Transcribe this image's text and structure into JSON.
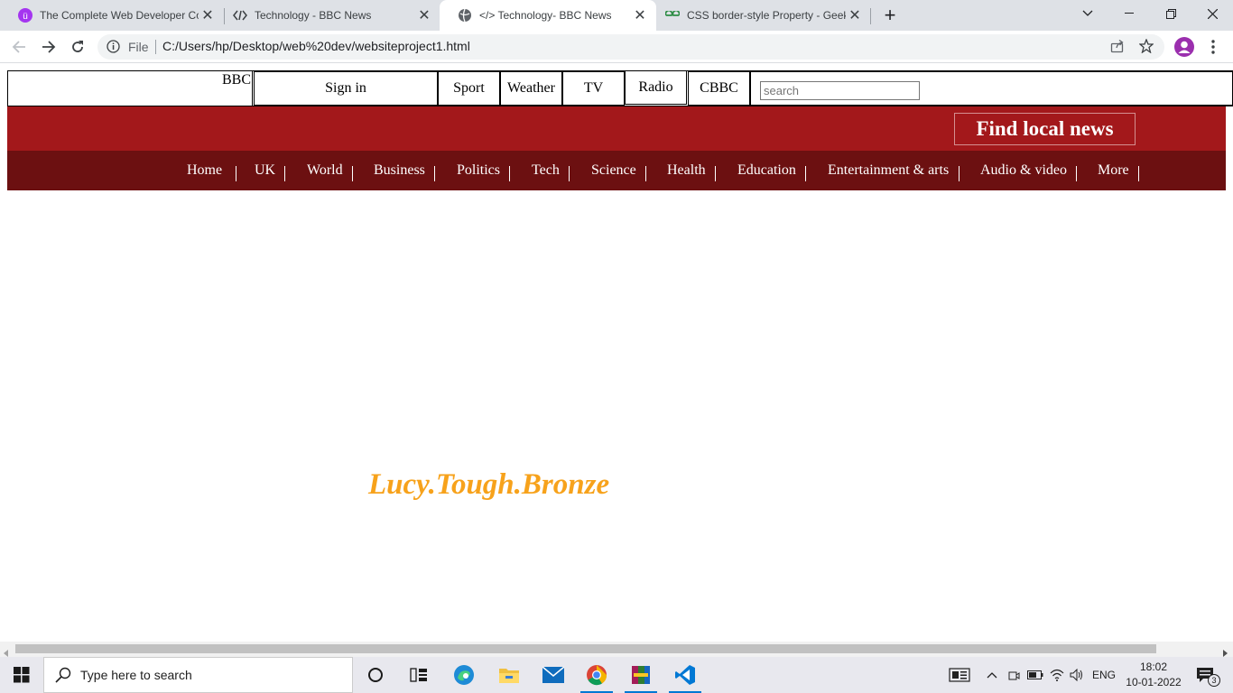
{
  "browser": {
    "tabs": [
      {
        "title": "The Complete Web Developer Co",
        "icon": "udemy-icon"
      },
      {
        "title": "Technology - BBC News",
        "icon": "code-icon"
      },
      {
        "title": "</> Technology- BBC News",
        "icon": "globe-icon"
      },
      {
        "title": "CSS border-style Property - Geek",
        "icon": "geeksforgeeks-icon"
      }
    ],
    "omnibox": {
      "scheme_label": "File",
      "url": "C:/Users/hp/Desktop/web%20dev/websiteproject1.html"
    }
  },
  "page": {
    "topnav": {
      "logo": "BBC",
      "sign_in": "Sign in",
      "sport": "Sport",
      "weather": "Weather",
      "tv": "TV",
      "radio": "Radio",
      "cbbc": "CBBC",
      "search_placeholder": "search"
    },
    "find_local_news": "Find local news",
    "nav_items": [
      "Home",
      "UK",
      "World",
      "Business",
      "Politics",
      "Tech",
      "Science",
      "Health",
      "Education",
      "Entertainment & arts",
      "Audio & video",
      "More"
    ],
    "tagline": "Lucy.Tough.Bronze",
    "colors": {
      "red_band": "#a3181b",
      "dark_nav": "#6c1011",
      "tagline": "#f7a21b"
    }
  },
  "taskbar": {
    "search_placeholder": "Type here to search",
    "language": "ENG",
    "time": "18:02",
    "date": "10-01-2022",
    "notification_count": "3"
  }
}
